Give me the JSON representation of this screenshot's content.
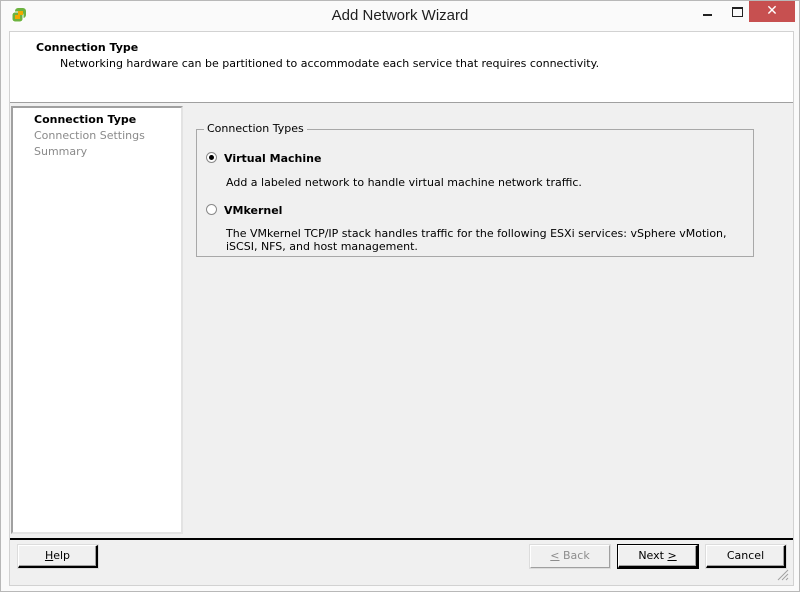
{
  "window": {
    "title": "Add Network Wizard",
    "icon": "vsphere-client-icon",
    "controls": {
      "minimize": "minimize",
      "maximize": "maximize",
      "close": "✕"
    }
  },
  "header": {
    "title": "Connection Type",
    "subtitle": "Networking hardware can be partitioned to accommodate each service that requires connectivity."
  },
  "steps": [
    {
      "label": "Connection Type",
      "state": "active"
    },
    {
      "label": "Connection Settings",
      "state": "inactive"
    },
    {
      "label": "Summary",
      "state": "inactive"
    }
  ],
  "connection_types": {
    "legend": "Connection Types",
    "options": [
      {
        "label": "Virtual Machine",
        "description": "Add a labeled network to handle virtual machine network traffic.",
        "selected": true
      },
      {
        "label": "VMkernel",
        "description": "The VMkernel TCP/IP stack handles traffic for the following ESXi services: vSphere vMotion, iSCSI, NFS, and host management.",
        "selected": false
      }
    ]
  },
  "buttons": {
    "help": {
      "mnemonic": "H",
      "rest": "elp"
    },
    "back": {
      "mnemonic": "<",
      "rest": " Back",
      "enabled": false
    },
    "next": {
      "prefix": "Next ",
      "mnemonic": ">",
      "enabled": true
    },
    "cancel": {
      "label": "Cancel"
    }
  }
}
